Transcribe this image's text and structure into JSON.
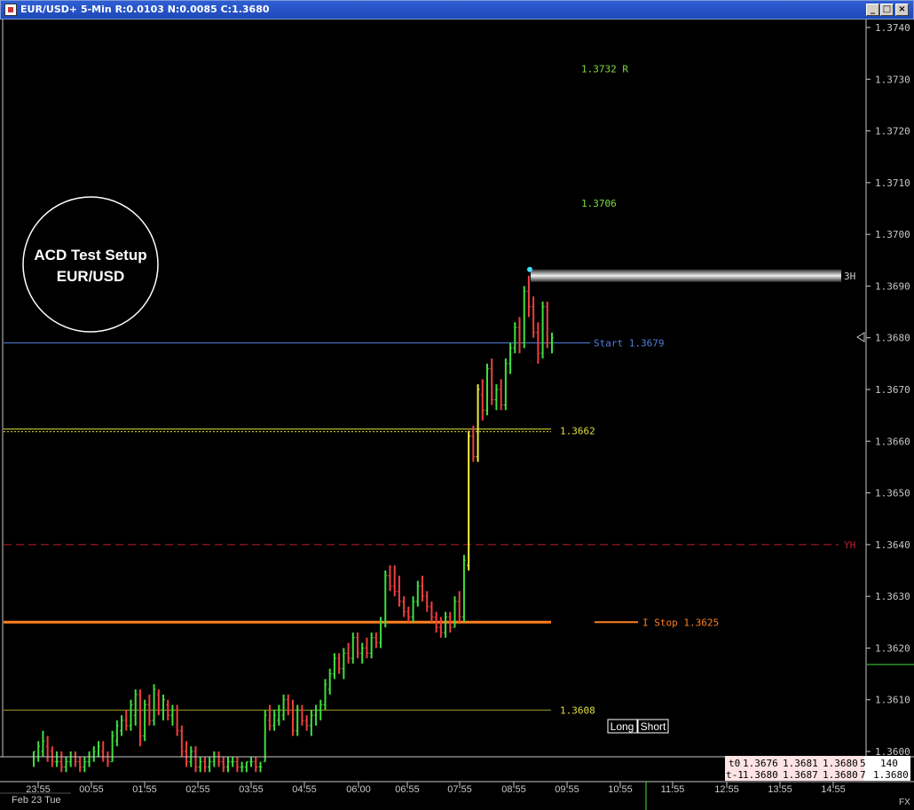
{
  "window": {
    "title": "EUR/USD+ 5-Min R:0.0103 N:0.0085 C:1.3680",
    "icon": "chart-app-icon",
    "buttons": [
      "minimize-icon",
      "maximize-icon",
      "close-icon"
    ]
  },
  "chart_data": {
    "type": "bar",
    "title": "EUR/USD+ 5-Min",
    "xlabel": "",
    "ylabel": "",
    "ylim": [
      1.3595,
      1.3745
    ],
    "y_ticks": [
      "1.3740",
      "1.3730",
      "1.3720",
      "1.3710",
      "1.3700",
      "1.3690",
      "1.3680",
      "1.3670",
      "1.3660",
      "1.3650",
      "1.3640",
      "1.3630",
      "1.3620",
      "1.3610",
      "1.3600"
    ],
    "x_ticks": [
      "23:55",
      "00:55",
      "01:55",
      "02:55",
      "03:55",
      "04:55",
      "06:00",
      "06:55",
      "07:55",
      "08:55",
      "09:55",
      "10:55",
      "11:55",
      "12:55",
      "13:55",
      "14:55"
    ],
    "date_label": "Feb 23 Tue",
    "grid": false,
    "bars": [
      {
        "o": 1.3599,
        "h": 1.36,
        "l": 1.3597,
        "c": 1.36
      },
      {
        "o": 1.3599,
        "h": 1.3602,
        "l": 1.3598,
        "c": 1.3601
      },
      {
        "o": 1.36,
        "h": 1.3604,
        "l": 1.3599,
        "c": 1.3602
      },
      {
        "o": 1.3601,
        "h": 1.3603,
        "l": 1.3598,
        "c": 1.3599
      },
      {
        "o": 1.36,
        "h": 1.3601,
        "l": 1.3597,
        "c": 1.3598
      },
      {
        "o": 1.3598,
        "h": 1.36,
        "l": 1.3597,
        "c": 1.3598
      },
      {
        "o": 1.3598,
        "h": 1.36,
        "l": 1.3596,
        "c": 1.3597
      },
      {
        "o": 1.3597,
        "h": 1.3599,
        "l": 1.3596,
        "c": 1.3598
      },
      {
        "o": 1.3598,
        "h": 1.36,
        "l": 1.3597,
        "c": 1.3599
      },
      {
        "o": 1.3599,
        "h": 1.36,
        "l": 1.3597,
        "c": 1.3598
      },
      {
        "o": 1.3598,
        "h": 1.3599,
        "l": 1.3596,
        "c": 1.3597
      },
      {
        "o": 1.3597,
        "h": 1.3599,
        "l": 1.3596,
        "c": 1.3598
      },
      {
        "o": 1.3598,
        "h": 1.36,
        "l": 1.3597,
        "c": 1.3599
      },
      {
        "o": 1.3599,
        "h": 1.3601,
        "l": 1.3598,
        "c": 1.36
      },
      {
        "o": 1.3599,
        "h": 1.3602,
        "l": 1.3599,
        "c": 1.3601
      },
      {
        "o": 1.36,
        "h": 1.3602,
        "l": 1.3598,
        "c": 1.3599
      },
      {
        "o": 1.3599,
        "h": 1.36,
        "l": 1.3597,
        "c": 1.3598
      },
      {
        "o": 1.3598,
        "h": 1.3604,
        "l": 1.3598,
        "c": 1.3603
      },
      {
        "o": 1.3602,
        "h": 1.3606,
        "l": 1.3601,
        "c": 1.3605
      },
      {
        "o": 1.3604,
        "h": 1.3607,
        "l": 1.3603,
        "c": 1.3606
      },
      {
        "o": 1.3606,
        "h": 1.3608,
        "l": 1.3604,
        "c": 1.3605
      },
      {
        "o": 1.3605,
        "h": 1.361,
        "l": 1.3604,
        "c": 1.3609
      },
      {
        "o": 1.3607,
        "h": 1.3612,
        "l": 1.3605,
        "c": 1.3611
      },
      {
        "o": 1.3611,
        "h": 1.3612,
        "l": 1.3601,
        "c": 1.3603
      },
      {
        "o": 1.3603,
        "h": 1.361,
        "l": 1.3602,
        "c": 1.3609
      },
      {
        "o": 1.3609,
        "h": 1.3611,
        "l": 1.3605,
        "c": 1.3606
      },
      {
        "o": 1.3606,
        "h": 1.3613,
        "l": 1.3605,
        "c": 1.3612
      },
      {
        "o": 1.3611,
        "h": 1.3612,
        "l": 1.3607,
        "c": 1.3608
      },
      {
        "o": 1.3608,
        "h": 1.3611,
        "l": 1.3606,
        "c": 1.361
      },
      {
        "o": 1.3609,
        "h": 1.361,
        "l": 1.3606,
        "c": 1.3607
      },
      {
        "o": 1.3607,
        "h": 1.3609,
        "l": 1.3605,
        "c": 1.3608
      },
      {
        "o": 1.3608,
        "h": 1.3609,
        "l": 1.3603,
        "c": 1.3604
      },
      {
        "o": 1.3604,
        "h": 1.3605,
        "l": 1.3599,
        "c": 1.36
      },
      {
        "o": 1.36,
        "h": 1.3602,
        "l": 1.3597,
        "c": 1.3598
      },
      {
        "o": 1.3598,
        "h": 1.3601,
        "l": 1.3597,
        "c": 1.36
      },
      {
        "o": 1.36,
        "h": 1.3601,
        "l": 1.3596,
        "c": 1.3597
      },
      {
        "o": 1.3597,
        "h": 1.3599,
        "l": 1.3596,
        "c": 1.3598
      },
      {
        "o": 1.3598,
        "h": 1.3599,
        "l": 1.3596,
        "c": 1.3597
      },
      {
        "o": 1.3597,
        "h": 1.3599,
        "l": 1.3596,
        "c": 1.3598
      },
      {
        "o": 1.3598,
        "h": 1.36,
        "l": 1.3597,
        "c": 1.3599
      },
      {
        "o": 1.3599,
        "h": 1.36,
        "l": 1.3597,
        "c": 1.3598
      },
      {
        "o": 1.3598,
        "h": 1.3599,
        "l": 1.3596,
        "c": 1.3597
      },
      {
        "o": 1.3597,
        "h": 1.3599,
        "l": 1.3596,
        "c": 1.3598
      },
      {
        "o": 1.3598,
        "h": 1.3599,
        "l": 1.3597,
        "c": 1.3598
      },
      {
        "o": 1.3598,
        "h": 1.3599,
        "l": 1.3596,
        "c": 1.3597
      },
      {
        "o": 1.3597,
        "h": 1.3598,
        "l": 1.3596,
        "c": 1.3597
      },
      {
        "o": 1.3597,
        "h": 1.3598,
        "l": 1.3596,
        "c": 1.3598
      },
      {
        "o": 1.3598,
        "h": 1.3599,
        "l": 1.3597,
        "c": 1.3598
      },
      {
        "o": 1.3598,
        "h": 1.3599,
        "l": 1.3596,
        "c": 1.3597
      },
      {
        "o": 1.3597,
        "h": 1.3598,
        "l": 1.3596,
        "c": 1.3597
      },
      {
        "o": 1.3598,
        "h": 1.3608,
        "l": 1.3598,
        "c": 1.3607
      },
      {
        "o": 1.3606,
        "h": 1.3609,
        "l": 1.3604,
        "c": 1.3605
      },
      {
        "o": 1.3605,
        "h": 1.3608,
        "l": 1.3604,
        "c": 1.3607
      },
      {
        "o": 1.3606,
        "h": 1.3609,
        "l": 1.3605,
        "c": 1.3608
      },
      {
        "o": 1.3607,
        "h": 1.3611,
        "l": 1.3606,
        "c": 1.361
      },
      {
        "o": 1.361,
        "h": 1.3611,
        "l": 1.3607,
        "c": 1.3608
      },
      {
        "o": 1.3608,
        "h": 1.361,
        "l": 1.3603,
        "c": 1.3604
      },
      {
        "o": 1.3604,
        "h": 1.3609,
        "l": 1.3603,
        "c": 1.3608
      },
      {
        "o": 1.3608,
        "h": 1.3609,
        "l": 1.3605,
        "c": 1.3606
      },
      {
        "o": 1.3606,
        "h": 1.3607,
        "l": 1.3604,
        "c": 1.3605
      },
      {
        "o": 1.3605,
        "h": 1.3608,
        "l": 1.3603,
        "c": 1.3607
      },
      {
        "o": 1.3607,
        "h": 1.3609,
        "l": 1.3605,
        "c": 1.3608
      },
      {
        "o": 1.3608,
        "h": 1.361,
        "l": 1.3606,
        "c": 1.3609
      },
      {
        "o": 1.3609,
        "h": 1.3614,
        "l": 1.3608,
        "c": 1.3613
      },
      {
        "o": 1.3612,
        "h": 1.3616,
        "l": 1.3611,
        "c": 1.3615
      },
      {
        "o": 1.3615,
        "h": 1.3619,
        "l": 1.3614,
        "c": 1.3618
      },
      {
        "o": 1.3618,
        "h": 1.3619,
        "l": 1.3615,
        "c": 1.3616
      },
      {
        "o": 1.3616,
        "h": 1.362,
        "l": 1.3614,
        "c": 1.3619
      },
      {
        "o": 1.3619,
        "h": 1.3621,
        "l": 1.3617,
        "c": 1.3618
      },
      {
        "o": 1.3618,
        "h": 1.3623,
        "l": 1.3617,
        "c": 1.3622
      },
      {
        "o": 1.3622,
        "h": 1.3623,
        "l": 1.3618,
        "c": 1.3619
      },
      {
        "o": 1.3619,
        "h": 1.3621,
        "l": 1.3617,
        "c": 1.362
      },
      {
        "o": 1.362,
        "h": 1.3622,
        "l": 1.3618,
        "c": 1.3619
      },
      {
        "o": 1.3619,
        "h": 1.3623,
        "l": 1.3618,
        "c": 1.3622
      },
      {
        "o": 1.3622,
        "h": 1.3623,
        "l": 1.362,
        "c": 1.3621
      },
      {
        "o": 1.3621,
        "h": 1.3626,
        "l": 1.362,
        "c": 1.3625
      },
      {
        "o": 1.3625,
        "h": 1.3635,
        "l": 1.3624,
        "c": 1.3634
      },
      {
        "o": 1.3634,
        "h": 1.3636,
        "l": 1.3631,
        "c": 1.3632
      },
      {
        "o": 1.3632,
        "h": 1.3636,
        "l": 1.363,
        "c": 1.3631
      },
      {
        "o": 1.3631,
        "h": 1.3634,
        "l": 1.3628,
        "c": 1.3629
      },
      {
        "o": 1.3629,
        "h": 1.363,
        "l": 1.3626,
        "c": 1.3627
      },
      {
        "o": 1.3627,
        "h": 1.3628,
        "l": 1.3625,
        "c": 1.3626
      },
      {
        "o": 1.3626,
        "h": 1.363,
        "l": 1.3625,
        "c": 1.3629
      },
      {
        "o": 1.3629,
        "h": 1.3633,
        "l": 1.3628,
        "c": 1.3632
      },
      {
        "o": 1.3632,
        "h": 1.3634,
        "l": 1.3629,
        "c": 1.363
      },
      {
        "o": 1.363,
        "h": 1.3631,
        "l": 1.3627,
        "c": 1.3628
      },
      {
        "o": 1.3628,
        "h": 1.3629,
        "l": 1.3625,
        "c": 1.3626
      },
      {
        "o": 1.3626,
        "h": 1.3627,
        "l": 1.3623,
        "c": 1.3624
      },
      {
        "o": 1.3624,
        "h": 1.3626,
        "l": 1.3622,
        "c": 1.3623
      },
      {
        "o": 1.3623,
        "h": 1.3627,
        "l": 1.3622,
        "c": 1.3626
      },
      {
        "o": 1.3626,
        "h": 1.3627,
        "l": 1.3623,
        "c": 1.3624
      },
      {
        "o": 1.3624,
        "h": 1.363,
        "l": 1.3624,
        "c": 1.3629
      },
      {
        "o": 1.3629,
        "h": 1.3631,
        "l": 1.3625,
        "c": 1.3626
      },
      {
        "o": 1.3626,
        "h": 1.3638,
        "l": 1.3625,
        "c": 1.3637
      },
      {
        "o": 1.3636,
        "h": 1.3662,
        "l": 1.3635,
        "c": 1.3661
      },
      {
        "o": 1.3661,
        "h": 1.3663,
        "l": 1.3656,
        "c": 1.3657
      },
      {
        "o": 1.3657,
        "h": 1.3671,
        "l": 1.3656,
        "c": 1.367
      },
      {
        "o": 1.3669,
        "h": 1.3672,
        "l": 1.3664,
        "c": 1.3666
      },
      {
        "o": 1.3666,
        "h": 1.3675,
        "l": 1.3665,
        "c": 1.3674
      },
      {
        "o": 1.3674,
        "h": 1.3676,
        "l": 1.3667,
        "c": 1.3668
      },
      {
        "o": 1.3668,
        "h": 1.3671,
        "l": 1.3666,
        "c": 1.367
      },
      {
        "o": 1.367,
        "h": 1.3672,
        "l": 1.3666,
        "c": 1.3667
      },
      {
        "o": 1.3667,
        "h": 1.3676,
        "l": 1.3666,
        "c": 1.3675
      },
      {
        "o": 1.3675,
        "h": 1.3679,
        "l": 1.3673,
        "c": 1.3678
      },
      {
        "o": 1.3678,
        "h": 1.3683,
        "l": 1.3677,
        "c": 1.3682
      },
      {
        "o": 1.3682,
        "h": 1.3684,
        "l": 1.3677,
        "c": 1.3679
      },
      {
        "o": 1.3679,
        "h": 1.369,
        "l": 1.3678,
        "c": 1.3689
      },
      {
        "o": 1.3689,
        "h": 1.3692,
        "l": 1.3684,
        "c": 1.3686
      },
      {
        "o": 1.3686,
        "h": 1.3688,
        "l": 1.368,
        "c": 1.3681
      },
      {
        "o": 1.3681,
        "h": 1.3683,
        "l": 1.3675,
        "c": 1.3677
      },
      {
        "o": 1.3677,
        "h": 1.3687,
        "l": 1.3676,
        "c": 1.3686
      },
      {
        "o": 1.3686,
        "h": 1.3687,
        "l": 1.3678,
        "c": 1.3679
      },
      {
        "o": 1.3679,
        "h": 1.3681,
        "l": 1.3677,
        "c": 1.368
      }
    ],
    "levels": [
      {
        "value": 1.3732,
        "label": "1.3732 R",
        "style": "label",
        "color": "#7fdf3f"
      },
      {
        "value": 1.3706,
        "label": "1.3706",
        "style": "label",
        "color": "#7fdf3f"
      },
      {
        "value": 1.3692,
        "label": "3H",
        "style": "band",
        "color": "#d0d0d0"
      },
      {
        "value": 1.3679,
        "label": "Start 1.3679",
        "style": "solid",
        "color": "#4f7fdf"
      },
      {
        "value": 1.3662,
        "label": "1.3662",
        "style": "double",
        "color": "#dfdf3f"
      },
      {
        "value": 1.364,
        "label": "YH",
        "style": "dashed",
        "color": "#c0202a"
      },
      {
        "value": 1.3625,
        "label": "I Stop 1.3625",
        "style": "thick",
        "color": "#ff7f1f"
      },
      {
        "value": 1.3608,
        "label": "1.3608",
        "style": "thin",
        "color": "#dfdf3f"
      }
    ]
  },
  "overlay": {
    "setup_line1": "ACD Test Setup",
    "setup_line2": "EUR/USD",
    "long_button": "Long",
    "short_button": "Short"
  },
  "quote_panel": [
    {
      "label": "t0",
      "a": "1.3676",
      "b": "1.3681",
      "c": "1.3680",
      "d": "5",
      "e": "140"
    },
    {
      "label": "t-1",
      "a": "1.3680",
      "b": "1.3687",
      "c": "1.3680",
      "d": "7",
      "e": "1.3680"
    }
  ],
  "footer_label": "FX",
  "colors": {
    "up": "#3fdf3f",
    "down": "#ef3f3f",
    "breakout": "#efef3f",
    "background": "#000000",
    "axis": "#c8c8c8"
  }
}
